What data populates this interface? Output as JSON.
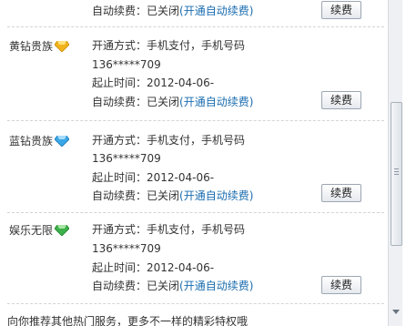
{
  "top_partial": {
    "auto_renew_label": "自动续费：",
    "auto_renew_status": "已关闭",
    "auto_renew_link": "(开通自动续费)",
    "renew_button": "续费"
  },
  "services": [
    {
      "name": "黄钻贵族",
      "gem_icon": "yellow-diamond-icon",
      "gem_color": "#f2b31b",
      "method_label": "开通方式：",
      "method_value": "手机支付，手机号码",
      "phone": "136*****709",
      "period_label": "起止时间：",
      "period_value": "2012-04-06-",
      "auto_renew_label": "自动续费：",
      "auto_renew_status": "已关闭",
      "auto_renew_link": "(开通自动续费)",
      "renew_button": "续费"
    },
    {
      "name": "蓝钻贵族",
      "gem_icon": "blue-diamond-icon",
      "gem_color": "#3aa7e6",
      "method_label": "开通方式：",
      "method_value": "手机支付，手机号码",
      "phone": "136*****709",
      "period_label": "起止时间：",
      "period_value": "2012-04-06-",
      "auto_renew_label": "自动续费：",
      "auto_renew_status": "已关闭",
      "auto_renew_link": "(开通自动续费)",
      "renew_button": "续费"
    },
    {
      "name": "娱乐无限",
      "gem_icon": "green-diamond-icon",
      "gem_color": "#3cb04a",
      "method_label": "开通方式：",
      "method_value": "手机支付，手机号码",
      "phone": "136*****709",
      "period_label": "起止时间：",
      "period_value": "2012-04-06-",
      "auto_renew_label": "自动续费：",
      "auto_renew_status": "已关闭",
      "auto_renew_link": "(开通自动续费)",
      "renew_button": "续费"
    }
  ],
  "footer": {
    "text": "向你推荐其他热门服务，更多不一样的精彩特权哦"
  },
  "colors": {
    "link": "#1b6db0",
    "divider": "#d4d4d4"
  }
}
